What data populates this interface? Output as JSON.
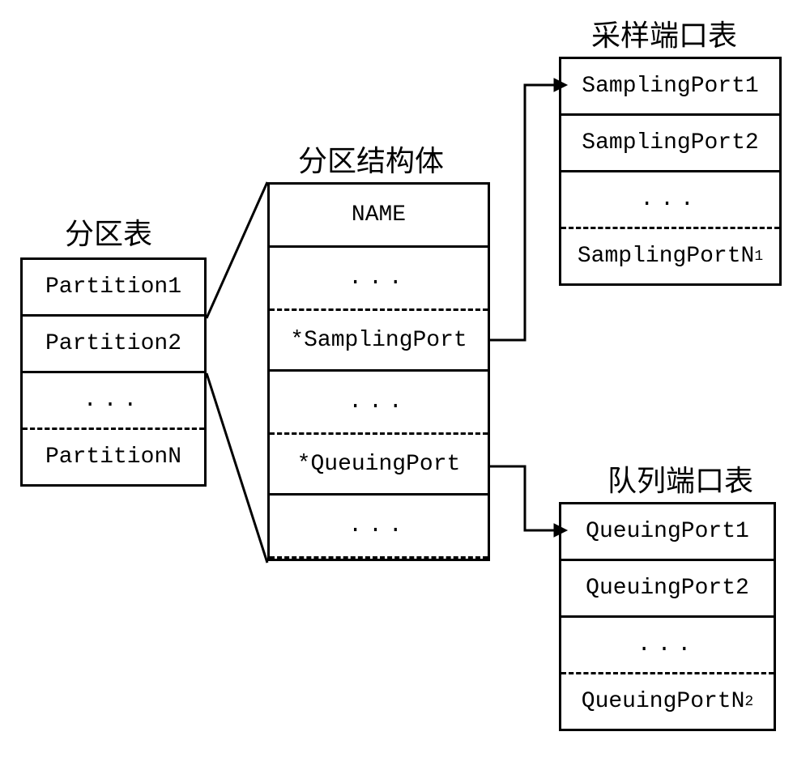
{
  "titles": {
    "partition_table": "分区表",
    "partition_struct": "分区结构体",
    "sampling_port_table": "采样端口表",
    "queuing_port_table": "队列端口表"
  },
  "partition_table": {
    "row1": "Partition1",
    "row2": "Partition2",
    "dots": "...",
    "rowN": "PartitionN"
  },
  "partition_struct": {
    "name": "NAME",
    "dots1": "...",
    "sampling_ptr": "*SamplingPort",
    "dots2": "...",
    "queuing_ptr": "*QueuingPort",
    "dots3": "..."
  },
  "sampling_port_table": {
    "row1": "SamplingPort1",
    "row2": "SamplingPort2",
    "dots": "...",
    "rowN_prefix": "SamplingPortN",
    "rowN_sub": "1"
  },
  "queuing_port_table": {
    "row1": "QueuingPort1",
    "row2": "QueuingPort2",
    "dots": "...",
    "rowN_prefix": "QueuingPortN",
    "rowN_sub": "2"
  }
}
